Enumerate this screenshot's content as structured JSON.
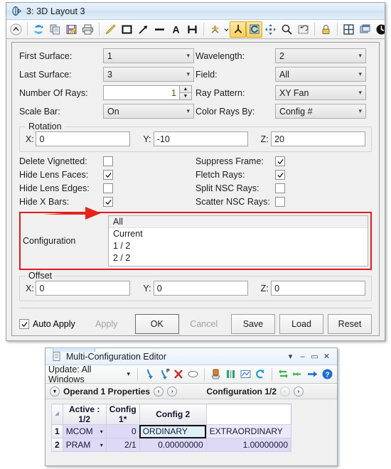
{
  "layout_window": {
    "title": "3: 3D Layout 3",
    "title_icon": "lens-icon",
    "toolbar": {
      "icons": [
        {
          "name": "collapse-icon",
          "glyph": "^"
        },
        {
          "name": "refresh-icon",
          "glyph": "refresh"
        },
        {
          "name": "copy-icon",
          "glyph": "copy"
        },
        {
          "name": "save-icon",
          "glyph": "save"
        },
        {
          "name": "print-icon",
          "glyph": "print"
        },
        {
          "name": "pencil-icon",
          "glyph": "pencil"
        },
        {
          "name": "rectangle-icon",
          "glyph": "rect"
        },
        {
          "name": "arrow-icon",
          "glyph": "arrow"
        },
        {
          "name": "line-icon",
          "glyph": "line"
        },
        {
          "name": "text-icon",
          "glyph": "A"
        },
        {
          "name": "dimension-icon",
          "glyph": "H"
        },
        {
          "name": "axes-dropdown-icon",
          "glyph": "axes"
        },
        {
          "name": "isometric-view-icon",
          "glyph": "iso"
        },
        {
          "name": "rotate-view-icon",
          "glyph": "rot"
        },
        {
          "name": "pan-icon",
          "glyph": "pan"
        },
        {
          "name": "zoom-icon",
          "glyph": "zoom"
        },
        {
          "name": "undo-zoom-icon",
          "glyph": "undo"
        },
        {
          "name": "lock-icon",
          "glyph": "lock"
        },
        {
          "name": "tile-icon",
          "glyph": "tile"
        },
        {
          "name": "windows-icon",
          "glyph": "win"
        },
        {
          "name": "refresh-dark-icon",
          "glyph": "refreshdark"
        }
      ],
      "cutoff_label": "L"
    },
    "fields": {
      "first_surface": {
        "label": "First Surface:",
        "value": "1"
      },
      "last_surface": {
        "label": "Last Surface:",
        "value": "3"
      },
      "number_of_rays": {
        "label": "Number Of Rays:",
        "value": "1"
      },
      "scale_bar": {
        "label": "Scale Bar:",
        "value": "On"
      },
      "wavelength": {
        "label": "Wavelength:",
        "value": "2"
      },
      "field": {
        "label": "Field:",
        "value": "All"
      },
      "ray_pattern": {
        "label": "Ray Pattern:",
        "value": "XY Fan"
      },
      "color_rays_by": {
        "label": "Color Rays By:",
        "value": "Config #"
      }
    },
    "rotation": {
      "title": "Rotation",
      "x_label": "X:",
      "x_value": "0",
      "y_label": "Y:",
      "y_value": "-10",
      "z_label": "Z:",
      "z_value": "20"
    },
    "checkboxes_left": [
      {
        "label": "Delete Vignetted:",
        "checked": false,
        "name": "delete-vignetted"
      },
      {
        "label": "Hide Lens Faces:",
        "checked": true,
        "name": "hide-lens-faces"
      },
      {
        "label": "Hide Lens Edges:",
        "checked": false,
        "name": "hide-lens-edges"
      },
      {
        "label": "Hide X Bars:",
        "checked": true,
        "name": "hide-x-bars"
      }
    ],
    "checkboxes_right": [
      {
        "label": "Suppress Frame:",
        "checked": true,
        "name": "suppress-frame"
      },
      {
        "label": "Fletch Rays:",
        "checked": true,
        "name": "fletch-rays"
      },
      {
        "label": "Split NSC Rays:",
        "checked": false,
        "name": "split-nsc-rays"
      },
      {
        "label": "Scatter NSC Rays:",
        "checked": false,
        "name": "scatter-nsc-rays"
      }
    ],
    "configuration": {
      "label": "Configuration",
      "highlight_color": "#e01b1b",
      "arrow_color": "#e8231a",
      "items": [
        {
          "label": "All",
          "selected": true
        },
        {
          "label": "Current",
          "selected": false
        },
        {
          "label": "1 / 2",
          "selected": false
        },
        {
          "label": "2 / 2",
          "selected": false
        }
      ]
    },
    "offset": {
      "title": "Offset",
      "x_label": "X:",
      "x_value": "0",
      "y_label": "Y:",
      "y_value": "0",
      "z_label": "Z:",
      "z_value": "0"
    },
    "footer": {
      "auto_apply_label": "Auto Apply",
      "auto_apply_checked": true,
      "apply_label": "Apply",
      "ok_label": "OK",
      "cancel_label": "Cancel",
      "save_label": "Save",
      "load_label": "Load",
      "reset_label": "Reset"
    }
  },
  "mce_window": {
    "title": "Multi-Configuration Editor",
    "title_icon": "document-icon",
    "window_buttons": [
      {
        "name": "dropdown-menu-button",
        "glyph": "▾"
      },
      {
        "name": "minimize-button",
        "glyph": "–"
      },
      {
        "name": "maximize-button",
        "glyph": "▭"
      },
      {
        "name": "close-button",
        "glyph": "✕"
      }
    ],
    "toolbar": {
      "update_label": "Update: All Windows",
      "update_caret": "▾",
      "icons": [
        {
          "name": "insert-operand-icon"
        },
        {
          "name": "insert-operand-p-icon"
        },
        {
          "name": "delete-operand-icon"
        },
        {
          "name": "ellipse-icon"
        },
        {
          "name": "config-insert-icon"
        },
        {
          "name": "columns-icon"
        },
        {
          "name": "edit-cell-icon"
        },
        {
          "name": "undo-icon"
        },
        {
          "name": "swap-icon"
        },
        {
          "name": "shift-icon"
        },
        {
          "name": "goto-icon"
        },
        {
          "name": "help-icon"
        }
      ]
    },
    "properties_bar": {
      "expander": "▾",
      "operand_label": "Operand 1 Properties",
      "operand_prev": "‹",
      "operand_next": "›",
      "config_label": "Configuration 1/2",
      "config_prev": "‹",
      "config_next": "›"
    },
    "grid": {
      "columns": [
        "",
        "Active : 1/2",
        "Config 1*",
        "Config 2"
      ],
      "rows": [
        {
          "num": "1",
          "operand": "MCOM",
          "operand_caret": "▾",
          "param": "0",
          "config1": "ORDINARY",
          "config2": "EXTRAORDINARY",
          "selected_cell": "config1"
        },
        {
          "num": "2",
          "operand": "PRAM",
          "operand_caret": "▾",
          "param": "2/1",
          "config1": "0.00000000",
          "config2": "1.00000000",
          "selected_cell": ""
        }
      ]
    }
  }
}
